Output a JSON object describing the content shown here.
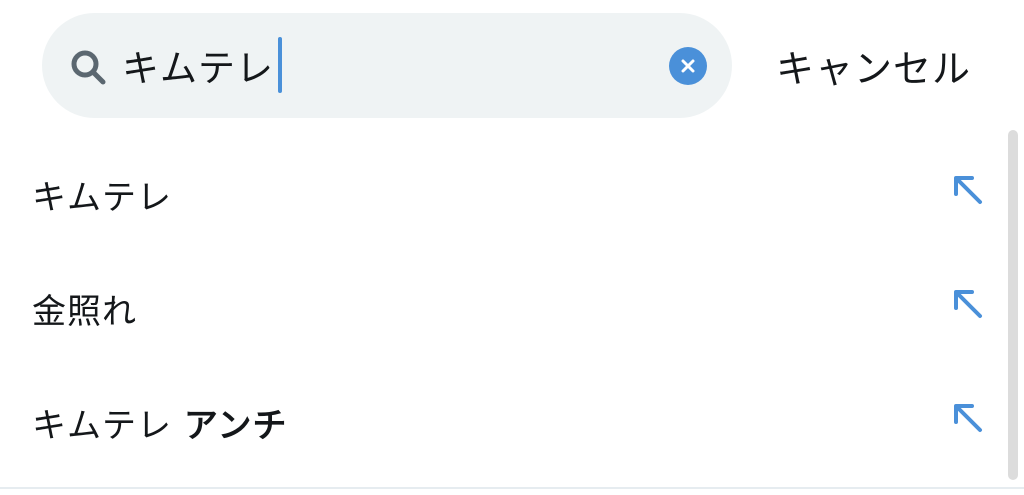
{
  "search": {
    "query": "キムテレ",
    "cancel_label": "キャンセル",
    "clear_icon": "clear-x-icon",
    "search_icon": "magnifier-icon"
  },
  "suggestions": [
    {
      "text": "キムテレ",
      "bold_suffix": "",
      "icon": "fill-query-arrow-icon"
    },
    {
      "text": "金照れ",
      "bold_suffix": "",
      "icon": "fill-query-arrow-icon"
    },
    {
      "text": "キムテレ ",
      "bold_suffix": "アンチ",
      "icon": "fill-query-arrow-icon"
    }
  ],
  "colors": {
    "accent": "#4a90d9",
    "search_bg": "#eff3f4",
    "text": "#14171a"
  }
}
